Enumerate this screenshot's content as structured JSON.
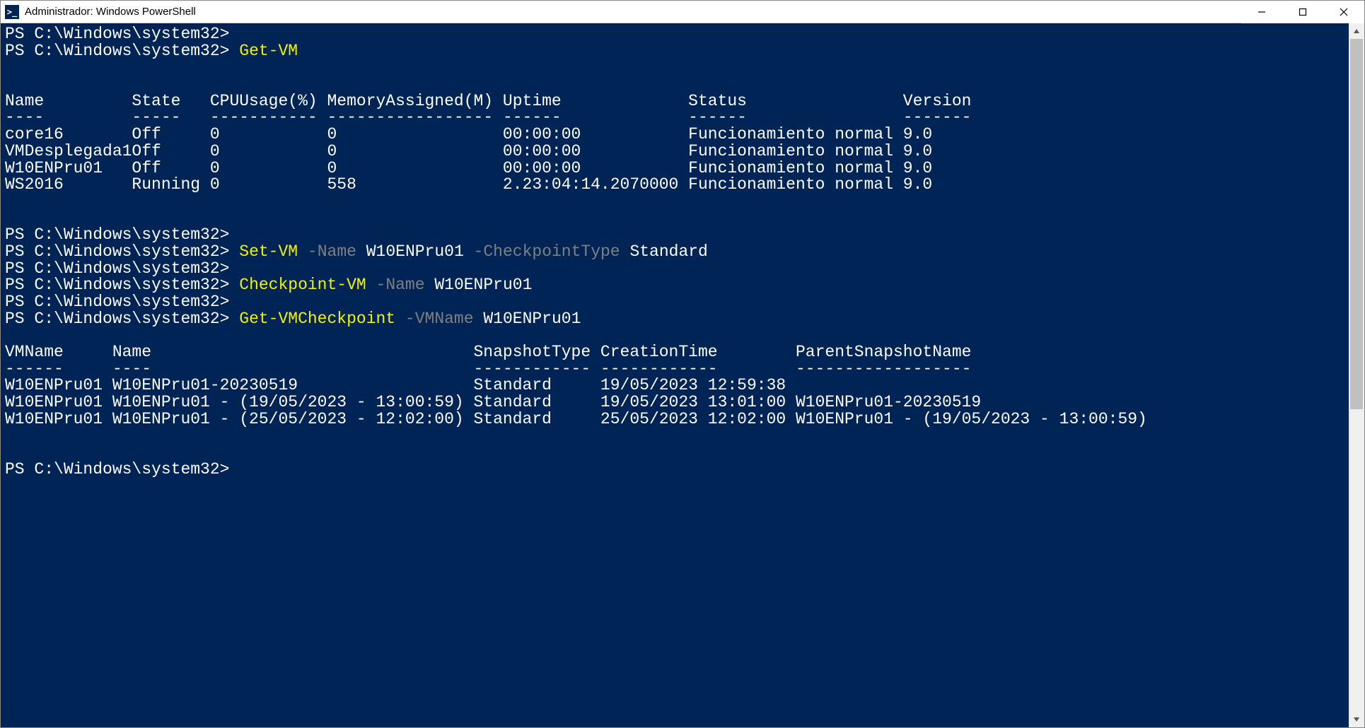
{
  "titlebar": {
    "title": "Administrador: Windows PowerShell",
    "icon_text": ">_"
  },
  "colors": {
    "bg": "#012456",
    "fg": "#ffffff",
    "cmd": "#f2f200",
    "param": "#808080"
  },
  "prompt": "PS C:\\Windows\\system32>",
  "commands": {
    "get_vm": "Get-VM",
    "set_vm": "Set-VM",
    "set_vm_param1": "-Name",
    "set_vm_arg1": "W10ENPru01",
    "set_vm_param2": "-CheckpointType",
    "set_vm_arg2": "Standard",
    "checkpoint_vm": "Checkpoint-VM",
    "checkpoint_param1": "-Name",
    "checkpoint_arg1": "W10ENPru01",
    "get_vmcp": "Get-VMCheckpoint",
    "get_vmcp_param1": "-VMName",
    "get_vmcp_arg1": "W10ENPru01"
  },
  "vm_table": {
    "headers": {
      "name": "Name",
      "state": "State",
      "cpu": "CPUUsage(%)",
      "mem": "MemoryAssigned(M)",
      "uptime": "Uptime",
      "status": "Status",
      "version": "Version"
    },
    "separators": {
      "name": "----",
      "state": "-----",
      "cpu": "-----------",
      "mem": "-----------------",
      "uptime": "------",
      "status": "------",
      "version": "-------"
    },
    "rows": [
      {
        "name": "core16",
        "state": "Off",
        "cpu": "0",
        "mem": "0",
        "uptime": "00:00:00",
        "status": "Funcionamiento normal",
        "version": "9.0"
      },
      {
        "name": "VMDesplegada1",
        "state": "Off",
        "cpu": "0",
        "mem": "0",
        "uptime": "00:00:00",
        "status": "Funcionamiento normal",
        "version": "9.0"
      },
      {
        "name": "W10ENPru01",
        "state": "Off",
        "cpu": "0",
        "mem": "0",
        "uptime": "00:00:00",
        "status": "Funcionamiento normal",
        "version": "9.0"
      },
      {
        "name": "WS2016",
        "state": "Running",
        "cpu": "0",
        "mem": "558",
        "uptime": "2.23:04:14.2070000",
        "status": "Funcionamiento normal",
        "version": "9.0"
      }
    ]
  },
  "cp_table": {
    "headers": {
      "vmname": "VMName",
      "name": "Name",
      "snaptype": "SnapshotType",
      "ctime": "CreationTime",
      "parent": "ParentSnapshotName"
    },
    "separators": {
      "vmname": "------",
      "name": "----",
      "snaptype": "------------",
      "ctime": "------------",
      "parent": "------------------"
    },
    "rows": [
      {
        "vmname": "W10ENPru01",
        "name": "W10ENPru01-20230519",
        "snaptype": "Standard",
        "ctime": "19/05/2023 12:59:38",
        "parent": ""
      },
      {
        "vmname": "W10ENPru01",
        "name": "W10ENPru01 - (19/05/2023 - 13:00:59)",
        "snaptype": "Standard",
        "ctime": "19/05/2023 13:01:00",
        "parent": "W10ENPru01-20230519"
      },
      {
        "vmname": "W10ENPru01",
        "name": "W10ENPru01 - (25/05/2023 - 12:02:00)",
        "snaptype": "Standard",
        "ctime": "25/05/2023 12:02:00",
        "parent": "W10ENPru01 - (19/05/2023 - 13:00:59)"
      }
    ]
  }
}
